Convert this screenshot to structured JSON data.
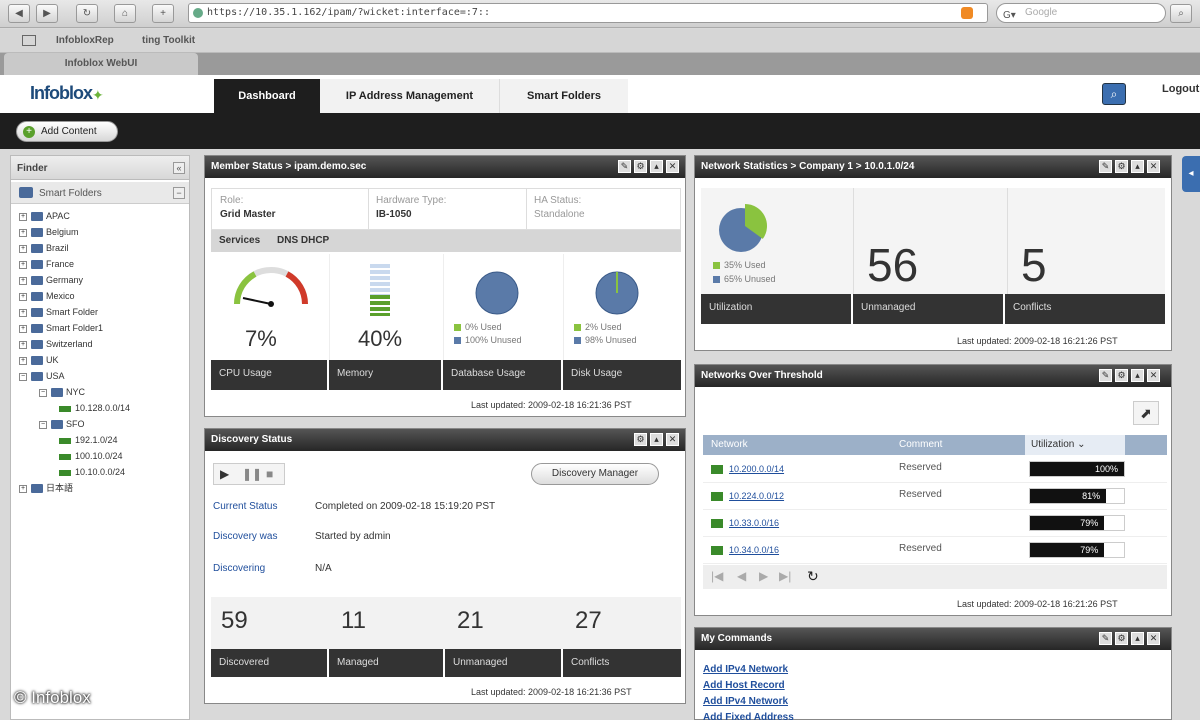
{
  "browser": {
    "address": "https://10.35.1.162/ipam/?wicket:interface=:7::",
    "search_placeholder": "Google",
    "bookmarks": [
      "InfobloxRep",
      "ting Toolkit"
    ],
    "tab_title": "Infoblox WebUI"
  },
  "header": {
    "logo": "Infoblox",
    "tabs": [
      "Dashboard",
      "IP Address Management",
      "Smart Folders"
    ],
    "logout": "Logout"
  },
  "toolbar": {
    "add_content": "Add Content"
  },
  "finder": {
    "title": "Finder",
    "smart_folders": "Smart Folders",
    "tree": [
      {
        "label": "APAC",
        "kind": "folder",
        "toggle": "+",
        "depth": 0
      },
      {
        "label": "Belgium",
        "kind": "folder",
        "toggle": "+",
        "depth": 0
      },
      {
        "label": "Brazil",
        "kind": "folder",
        "toggle": "+",
        "depth": 0
      },
      {
        "label": "France",
        "kind": "folder",
        "toggle": "+",
        "depth": 0
      },
      {
        "label": "Germany",
        "kind": "folder",
        "toggle": "+",
        "depth": 0
      },
      {
        "label": "Mexico",
        "kind": "folder",
        "toggle": "+",
        "depth": 0
      },
      {
        "label": "Smart Folder",
        "kind": "folder",
        "toggle": "+",
        "depth": 0
      },
      {
        "label": "Smart Folder1",
        "kind": "folder",
        "toggle": "+",
        "depth": 0
      },
      {
        "label": "Switzerland",
        "kind": "folder",
        "toggle": "+",
        "depth": 0
      },
      {
        "label": "UK",
        "kind": "folder",
        "toggle": "+",
        "depth": 0
      },
      {
        "label": "USA",
        "kind": "folder",
        "toggle": "−",
        "depth": 0
      },
      {
        "label": "NYC",
        "kind": "folder",
        "toggle": "−",
        "depth": 1
      },
      {
        "label": "10.128.0.0/14",
        "kind": "network",
        "toggle": "",
        "depth": 2
      },
      {
        "label": "SFO",
        "kind": "folder",
        "toggle": "−",
        "depth": 1
      },
      {
        "label": "192.1.0/24",
        "kind": "network",
        "toggle": "",
        "depth": 2
      },
      {
        "label": "100.10.0/24",
        "kind": "network",
        "toggle": "",
        "depth": 2
      },
      {
        "label": "10.10.0.0/24",
        "kind": "network",
        "toggle": "",
        "depth": 2
      },
      {
        "label": "日本語",
        "kind": "folder",
        "toggle": "+",
        "depth": 0
      }
    ]
  },
  "member_status": {
    "title": "Member Status > ipam.demo.sec",
    "role_label": "Role:",
    "role_value": "Grid Master",
    "hw_label": "Hardware Type:",
    "hw_value": "IB-1050",
    "ha_label": "HA Status:",
    "ha_value": "Standalone",
    "services_label": "Services",
    "services_value": "DNS DHCP",
    "cpu_value": "7%",
    "cpu_label": "CPU Usage",
    "memory_value": "40%",
    "memory_label": "Memory",
    "db_used": "0% Used",
    "db_unused": "100% Unused",
    "db_label": "Database Usage",
    "disk_used": "2% Used",
    "disk_unused": "98% Unused",
    "disk_label": "Disk Usage",
    "updated": "Last updated: 2009-02-18 16:21:36 PST"
  },
  "discovery": {
    "title": "Discovery Status",
    "manager_button": "Discovery Manager",
    "current_status_label": "Current Status",
    "current_status_value": "Completed on 2009-02-18 15:19:20 PST",
    "discovery_was_label": "Discovery was",
    "discovery_was_value": "Started by admin",
    "discovering_label": "Discovering",
    "discovering_value": "N/A",
    "stats": [
      {
        "value": "59",
        "label": "Discovered"
      },
      {
        "value": "11",
        "label": "Managed"
      },
      {
        "value": "21",
        "label": "Unmanaged"
      },
      {
        "value": "27",
        "label": "Conflicts"
      }
    ],
    "updated": "Last updated: 2009-02-18 16:21:36 PST"
  },
  "network_stats": {
    "title": "Network Statistics > Company 1 > 10.0.1.0/24",
    "used_pct": 35,
    "used": "35% Used",
    "unused": "65% Unused",
    "big1": "56",
    "big2": "5",
    "labels": [
      "Utilization",
      "Unmanaged",
      "Conflicts"
    ],
    "updated": "Last updated: 2009-02-18 16:21:26 PST"
  },
  "networks_threshold": {
    "title": "Networks Over Threshold",
    "headers": [
      "Network",
      "Comment",
      "Utilization"
    ],
    "rows": [
      {
        "network": "10.200.0.0/14",
        "comment": "Reserved",
        "pct": 100,
        "label": "100%"
      },
      {
        "network": "10.224.0.0/12",
        "comment": "Reserved",
        "pct": 81,
        "label": "81%"
      },
      {
        "network": "10.33.0.0/16",
        "comment": "",
        "pct": 79,
        "label": "79%"
      },
      {
        "network": "10.34.0.0/16",
        "comment": "Reserved",
        "pct": 79,
        "label": "79%"
      }
    ],
    "updated": "Last updated: 2009-02-18 16:21:26 PST"
  },
  "commands": {
    "title": "My Commands",
    "links": [
      "Add IPv4 Network",
      "Add Host Record",
      "Add IPv4 Network",
      "Add Fixed Address"
    ]
  },
  "watermark": "© Infoblox",
  "colors": {
    "accent_green": "#8ac33f",
    "accent_blue": "#5a7aa8",
    "bar_dark": "#111111"
  }
}
